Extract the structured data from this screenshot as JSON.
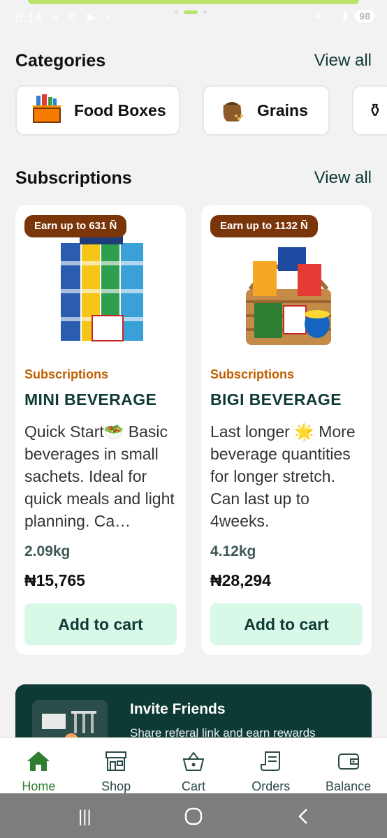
{
  "status_bar": {
    "time": "8:14",
    "battery": "98"
  },
  "categories": {
    "title": "Categories",
    "view_all": "View all",
    "items": [
      {
        "label": "Food Boxes",
        "icon": "food-box-icon"
      },
      {
        "label": "Grains",
        "icon": "grains-sack-icon"
      }
    ]
  },
  "subscriptions": {
    "title": "Subscriptions",
    "view_all": "View all",
    "items": [
      {
        "badge": "Earn up to 631 Ñ",
        "category": "Subscriptions",
        "name": "MINI BEVERAGE",
        "description": "Quick Start🥗 Basic beverages in small sachets. Ideal for quick meals and light planning. Ca…",
        "weight": "2.09kg",
        "price": "₦15,765",
        "button": "Add to cart"
      },
      {
        "badge": "Earn up to 1132 Ñ",
        "category": "Subscriptions",
        "name": "BIGI BEVERAGE",
        "description": "Last longer 🌟 More beverage quantities for longer stretch. Can last up to 4weeks.",
        "weight": "4.12kg",
        "price": "₦28,294",
        "button": "Add to cart"
      }
    ]
  },
  "invite": {
    "title": "Invite Friends",
    "subtitle": "Share referal link and earn rewards"
  },
  "bottom_nav": {
    "items": [
      {
        "label": "Home",
        "icon": "home-icon",
        "active": true
      },
      {
        "label": "Shop",
        "icon": "shop-icon",
        "active": false
      },
      {
        "label": "Cart",
        "icon": "basket-icon",
        "active": false
      },
      {
        "label": "Orders",
        "icon": "receipt-icon",
        "active": false
      },
      {
        "label": "Balance",
        "icon": "wallet-icon",
        "active": false
      }
    ]
  },
  "colors": {
    "accent_green": "#2e7d32",
    "dark_teal": "#0f3a35",
    "badge_brown": "#7a3609",
    "category_orange": "#c05f00",
    "button_mint": "#d8f8e8"
  }
}
